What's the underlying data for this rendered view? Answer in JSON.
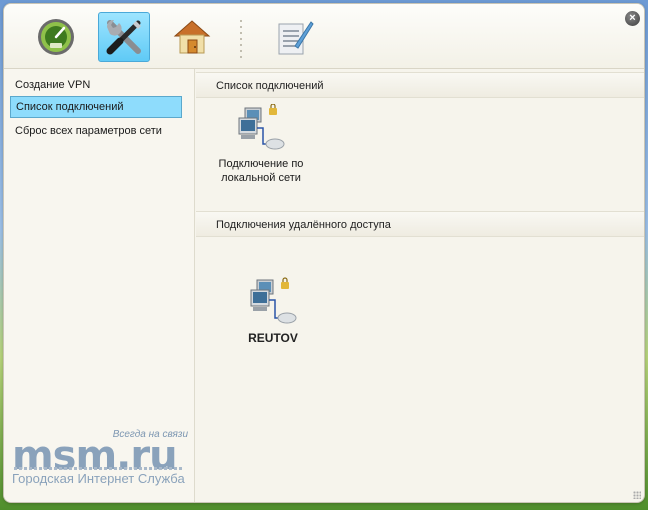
{
  "toolbar": {
    "buttons": [
      {
        "name": "gauge-icon",
        "active": false
      },
      {
        "name": "tools-icon",
        "active": true
      },
      {
        "name": "home-icon",
        "active": false
      },
      {
        "name": "notepad-icon",
        "active": false
      }
    ],
    "close_label": "×"
  },
  "sidebar": {
    "items": [
      {
        "label": "Создание VPN",
        "selected": false
      },
      {
        "label": "Список подключений",
        "selected": true
      },
      {
        "label": "Сброс всех параметров сети",
        "selected": false
      }
    ],
    "logo": {
      "tagline": "Всегда на связи",
      "brand": "msm.ru",
      "subtitle": "Городская Интернет Служба"
    }
  },
  "main": {
    "sections": [
      {
        "title": "Список подключений",
        "connections": [
          {
            "label": "Подключение по локальной сети",
            "icon": "network-computers-icon"
          }
        ]
      },
      {
        "title": "Подключения удалённого доступа",
        "connections": [
          {
            "label": "REUTOV",
            "icon": "network-computers-icon"
          }
        ]
      }
    ]
  }
}
